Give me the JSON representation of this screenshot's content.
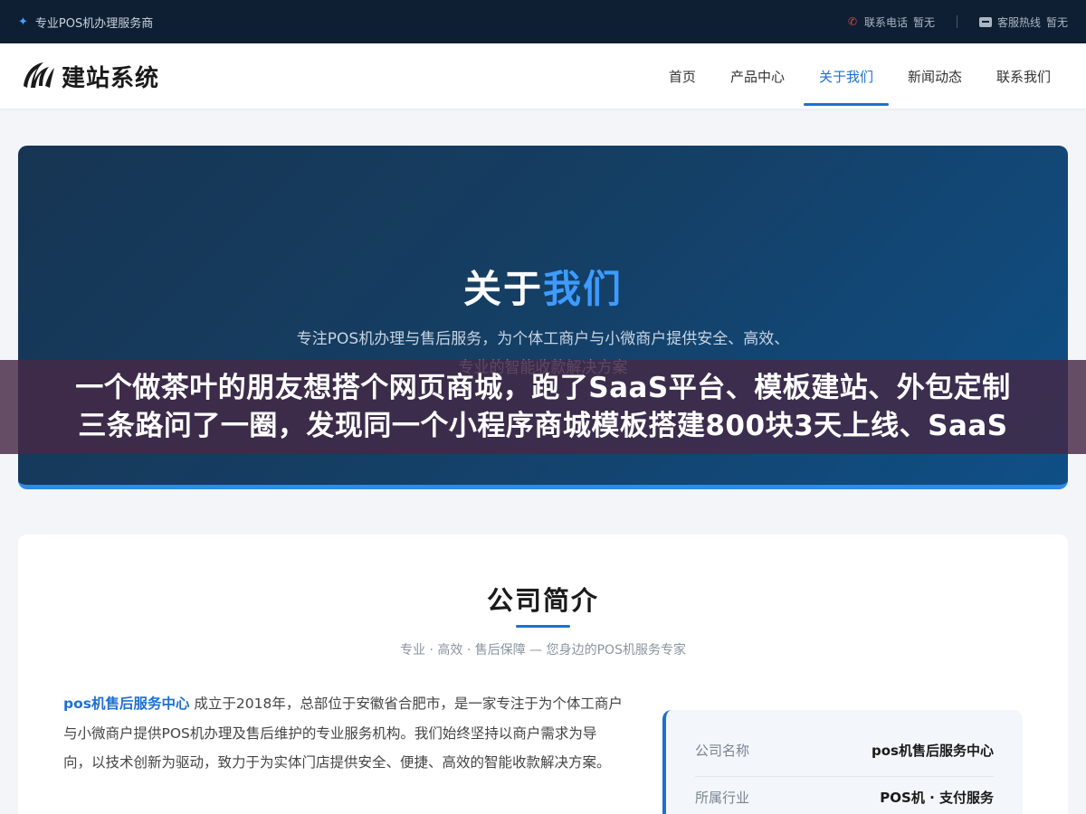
{
  "topbar": {
    "tagline": "专业POS机办理服务商",
    "phone_label": "联系电话",
    "phone_value": "暂无",
    "hotline_label": "客服热线",
    "hotline_value": "暂无",
    "icons": {
      "tagline": "sparkle-icon",
      "phone": "phone-icon",
      "hotline": "chat-icon"
    }
  },
  "header": {
    "logo_text": "建站系统",
    "nav": [
      {
        "label": "首页",
        "active": false
      },
      {
        "label": "产品中心",
        "active": false
      },
      {
        "label": "关于我们",
        "active": true
      },
      {
        "label": "新闻动态",
        "active": false
      },
      {
        "label": "联系我们",
        "active": false
      }
    ]
  },
  "hero": {
    "title_plain": "关于",
    "title_highlight": "我们",
    "subtitle_line1": "专注POS机办理与售后服务，为个体工商户与小微商户提供安全、高效、",
    "subtitle_line2": "专业的智能收款解决方案"
  },
  "overlay": {
    "line1": "一个做茶叶的朋友想搭个网页商城，跑了SaaS平台、模板建站、外包定制",
    "line2": "三条路问了一圈，发现同一个小程序商城模板搭建800块3天上线、SaaS"
  },
  "company": {
    "title": "公司简介",
    "subtitle": "专业 · 高效 · 售后保障 — 您身边的POS机服务专家",
    "intro_brand": "pos机售后服务中心",
    "intro_text": " 成立于2018年，总部位于安徽省合肥市，是一家专注于为个体工商户与小微商户提供POS机办理及售后维护的专业服务机构。我们始终坚持以商户需求为导向，以技术创新为驱动，致力于为实体门店提供安全、便捷、高效的智能收款解决方案。",
    "info": [
      {
        "label": "公司名称",
        "value": "pos机售后服务中心"
      },
      {
        "label": "所属行业",
        "value": "POS机 · 支付服务"
      }
    ]
  },
  "colors": {
    "accent": "#1e6fd0",
    "topbar_bg": "#0f1f33",
    "hero_highlight": "#3d9bff",
    "overlay_bg": "rgba(70,40,70,0.82)"
  }
}
